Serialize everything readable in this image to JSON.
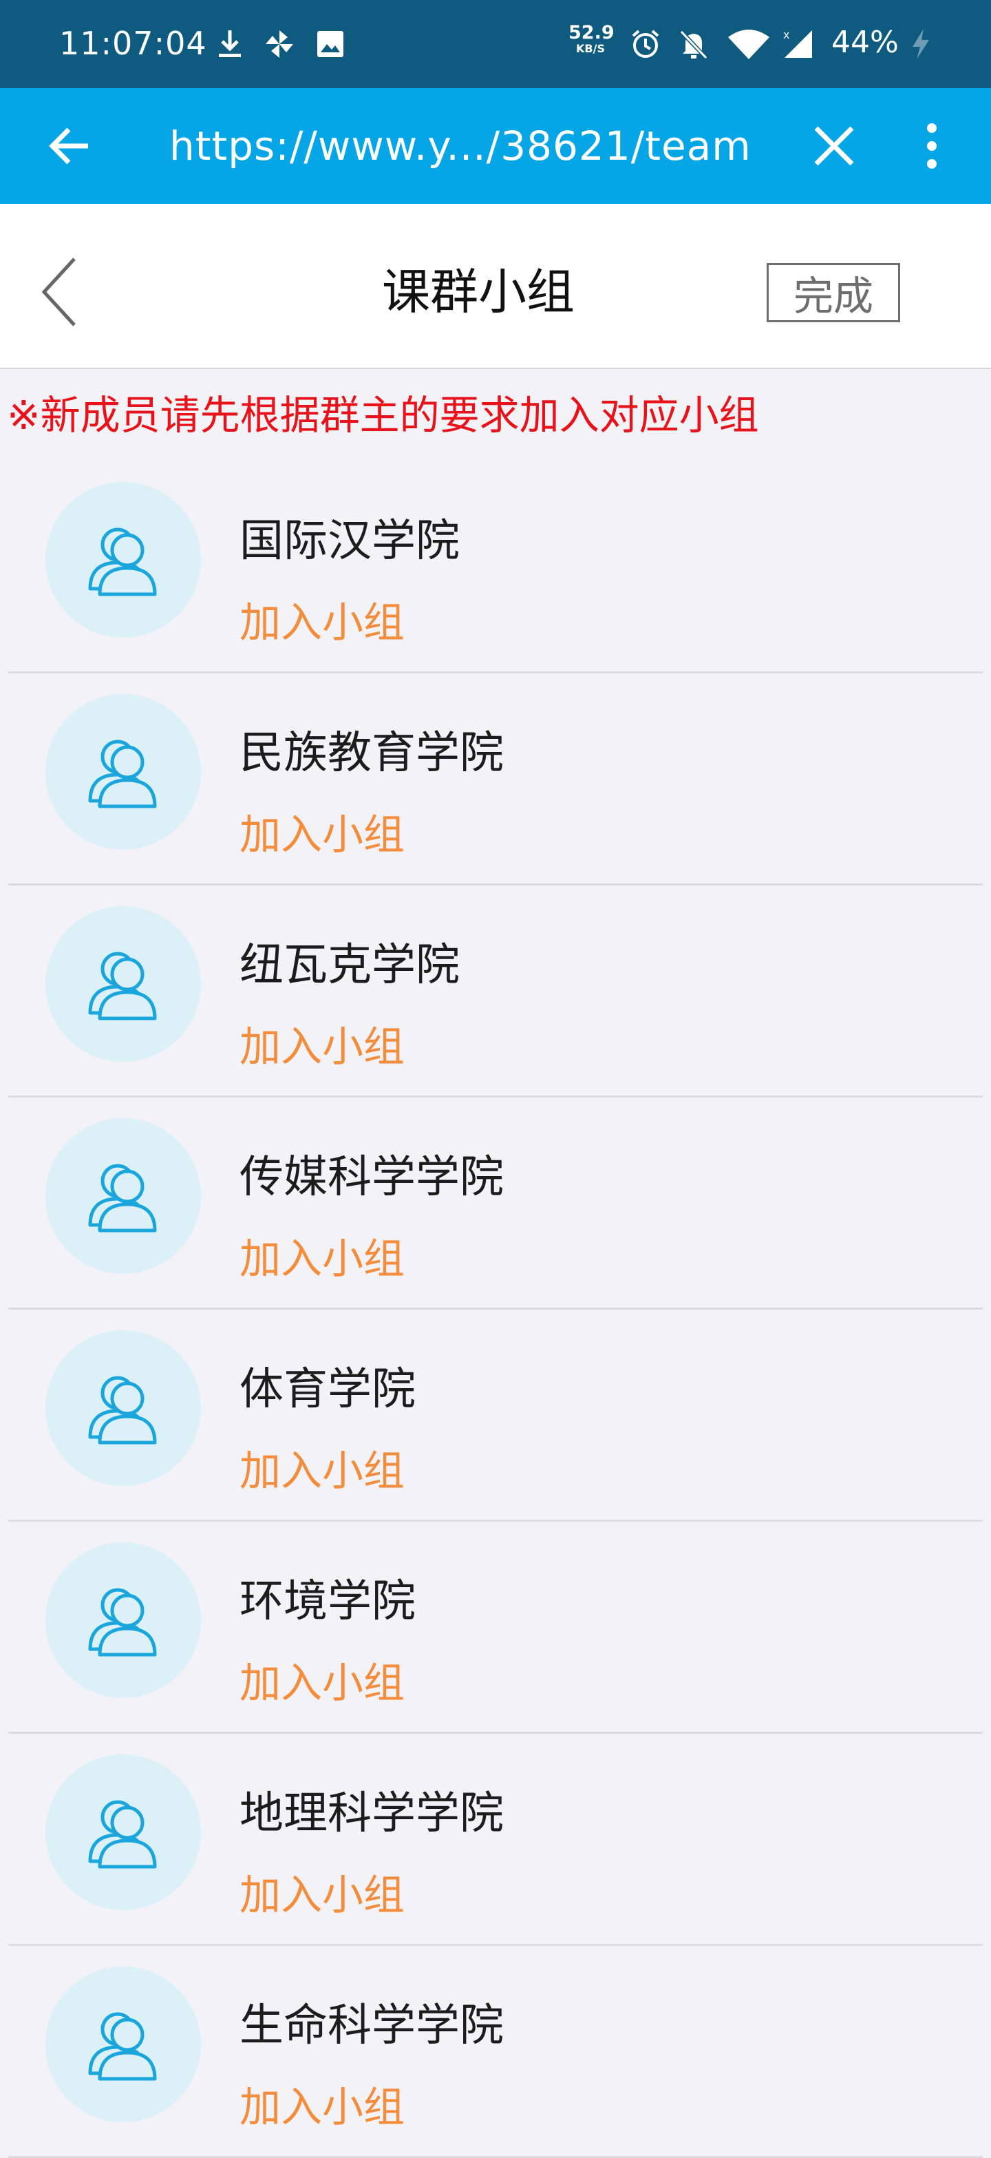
{
  "status_bar": {
    "time": "11:07:04",
    "net_speed_value": "52.9",
    "net_speed_unit": "KB/S",
    "battery": "44%",
    "icons": [
      "download-icon",
      "pinwheel-icon",
      "image-icon",
      "alarm-icon",
      "mute-bell-icon",
      "wifi-icon",
      "signal-icon",
      "charging-icon"
    ]
  },
  "browser": {
    "url": "https://www.y.../38621/team",
    "icons": [
      "back-arrow-icon",
      "close-icon",
      "more-vertical-icon"
    ]
  },
  "header": {
    "title": "课群小组",
    "done_label": "完成"
  },
  "notice": "※新成员请先根据群主的要求加入对应小组",
  "groups": [
    {
      "name": "国际汉学院",
      "action": "加入小组"
    },
    {
      "name": "民族教育学院",
      "action": "加入小组"
    },
    {
      "name": "纽瓦克学院",
      "action": "加入小组"
    },
    {
      "name": "传媒科学学院",
      "action": "加入小组"
    },
    {
      "name": "体育学院",
      "action": "加入小组"
    },
    {
      "name": "环境学院",
      "action": "加入小组"
    },
    {
      "name": "地理科学学院",
      "action": "加入小组"
    },
    {
      "name": "生命科学学院",
      "action": "加入小组"
    }
  ],
  "colors": {
    "status_bar": "#0f5b80",
    "browser_bar": "#05a5e6",
    "notice": "#e8131a",
    "join": "#f38d3c",
    "avatar_bg": "#dcf0f8",
    "avatar_stroke": "#1aa6dc"
  }
}
